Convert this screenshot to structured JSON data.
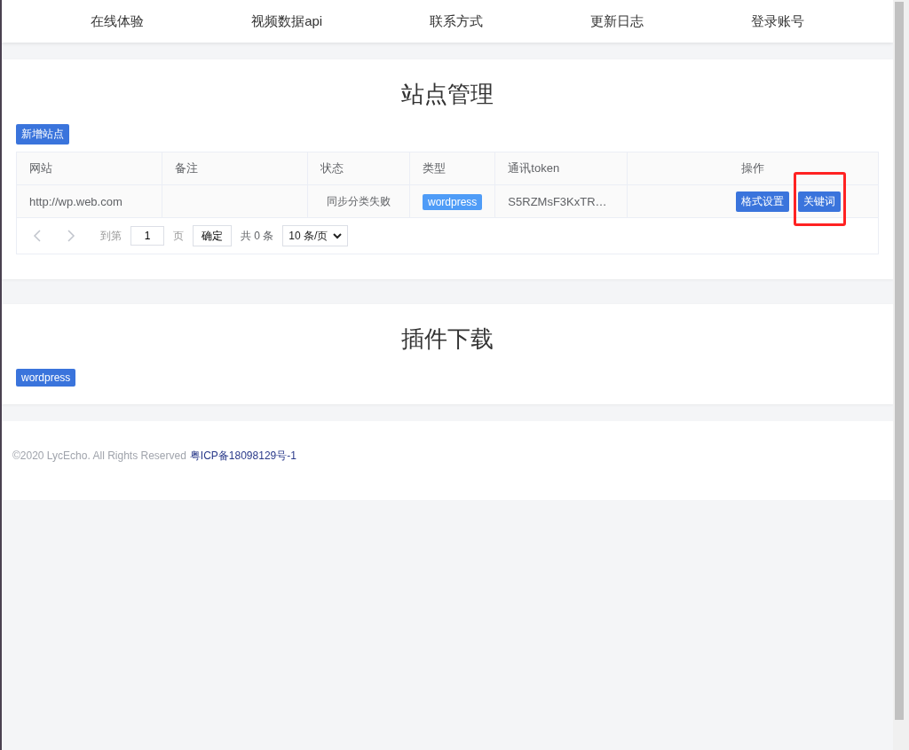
{
  "nav": {
    "items": [
      "在线体验",
      "视频数据api",
      "联系方式",
      "更新日志",
      "登录账号"
    ]
  },
  "sites": {
    "title": "站点管理",
    "add_button": "新增站点",
    "table": {
      "columns": [
        "网站",
        "备注",
        "状态",
        "类型",
        "通讯token",
        "操作"
      ],
      "rows": [
        {
          "site": "http://wp.web.com",
          "note": "",
          "status": "同步分类失败",
          "type": "wordpress",
          "token": "S5RZMsF3KxTR…",
          "actions": [
            {
              "label": "格式设置",
              "highlighted": false
            },
            {
              "label": "关键词",
              "highlighted": true
            }
          ]
        }
      ]
    },
    "pagination": {
      "goto_label": "到第",
      "page": "1",
      "page_suffix": "页",
      "confirm": "确定",
      "total": "共 0 条",
      "page_size": "10 条/页"
    }
  },
  "plugins": {
    "title": "插件下载",
    "items": [
      "wordpress"
    ]
  },
  "footer": {
    "copyright": "©2020 LycEcho. All Rights Reserved",
    "icp": "粤ICP备18098129号-1"
  }
}
